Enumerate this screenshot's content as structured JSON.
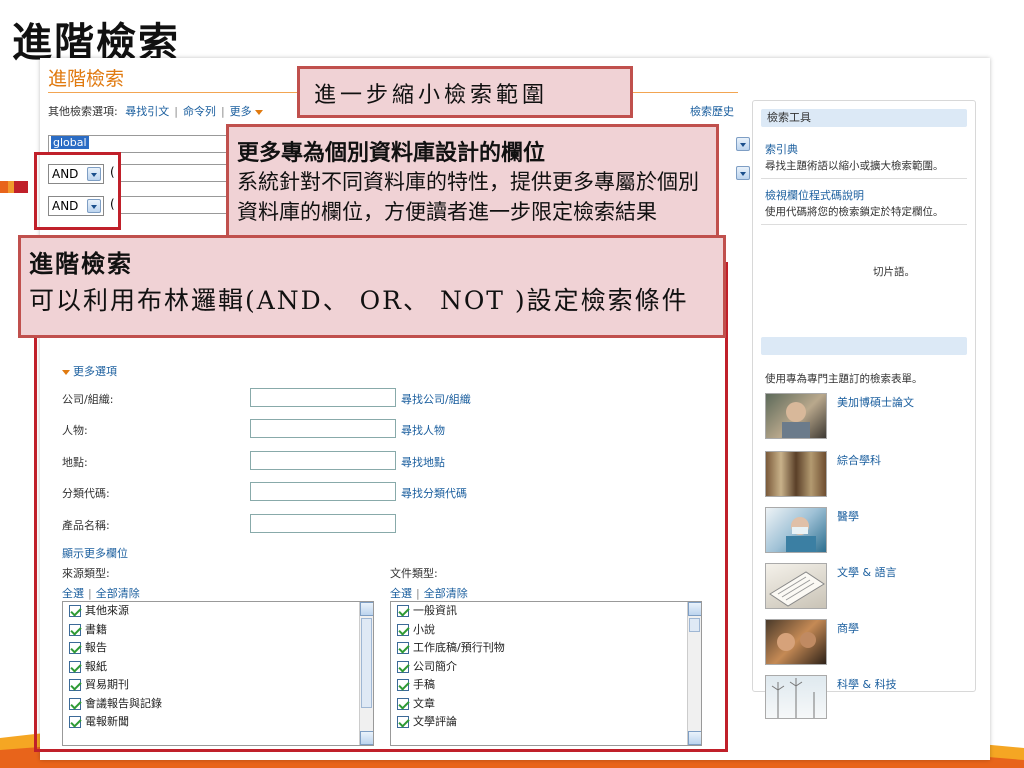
{
  "slide": {
    "title": "進階檢索"
  },
  "page": {
    "heading": "進階檢索",
    "other_options_label": "其他檢索選項:",
    "other_options": [
      "尋找引文",
      "命令列",
      "更多"
    ],
    "search_history": "檢索歷史",
    "keyword_value": "global",
    "operators": [
      "AND",
      "AND"
    ],
    "paren": "(",
    "more_options": "更多選項",
    "fields": [
      {
        "label": "公司/組織:",
        "link": "尋找公司/組織"
      },
      {
        "label": "人物:",
        "link": "尋找人物"
      },
      {
        "label": "地點:",
        "link": "尋找地點"
      },
      {
        "label": "分類代碼:",
        "link": "尋找分類代碼"
      },
      {
        "label": "產品名稱:",
        "link": ""
      }
    ],
    "show_more_fields": "顯示更多欄位",
    "source_type_label": "來源類型:",
    "doc_type_label": "文件類型:",
    "select_all": "全選",
    "clear_all": "全部清除",
    "source_types": [
      "其他來源",
      "書籍",
      "報告",
      "報紙",
      "貿易期刊",
      "會議報告與記錄",
      "電報新聞"
    ],
    "doc_types": [
      "一般資訊",
      "小說",
      "工作底稿/預行刊物",
      "公司簡介",
      "手稿",
      "文章",
      "文學評論"
    ]
  },
  "tools": {
    "header": "檢索工具",
    "items": [
      {
        "title": "索引典",
        "desc": "尋找主題術語以縮小或擴大檢索範圍。"
      },
      {
        "title": "檢視欄位程式碼說明",
        "desc": "使用代碼將您的檢索鎖定於特定欄位。"
      }
    ],
    "partial_desc": "切片語。",
    "subjects_desc": "使用專為專門主題訂的檢索表單。",
    "subjects": [
      "美加博碩士論文",
      "綜合學科",
      "醫學",
      "文學 & 語言",
      "商學",
      "科學 & 科技"
    ]
  },
  "callouts": {
    "narrow": "進一步縮小檢索範圍",
    "db_fields_title": "更多專為個別資料庫設計的欄位",
    "db_fields_body": "系統針對不同資料庫的特性，提供更多專屬於個別資料庫的欄位，方便讀者進一步限定檢索結果",
    "adv_title": "進階檢索",
    "adv_body": "可以利用布林邏輯(AND、 OR、 NOT )設定檢索條件"
  },
  "colors": {
    "accent_orange": "#e07a10",
    "link_blue": "#1a5e9e",
    "callout_fill": "#f0d2d5",
    "callout_border": "#c0504d"
  }
}
